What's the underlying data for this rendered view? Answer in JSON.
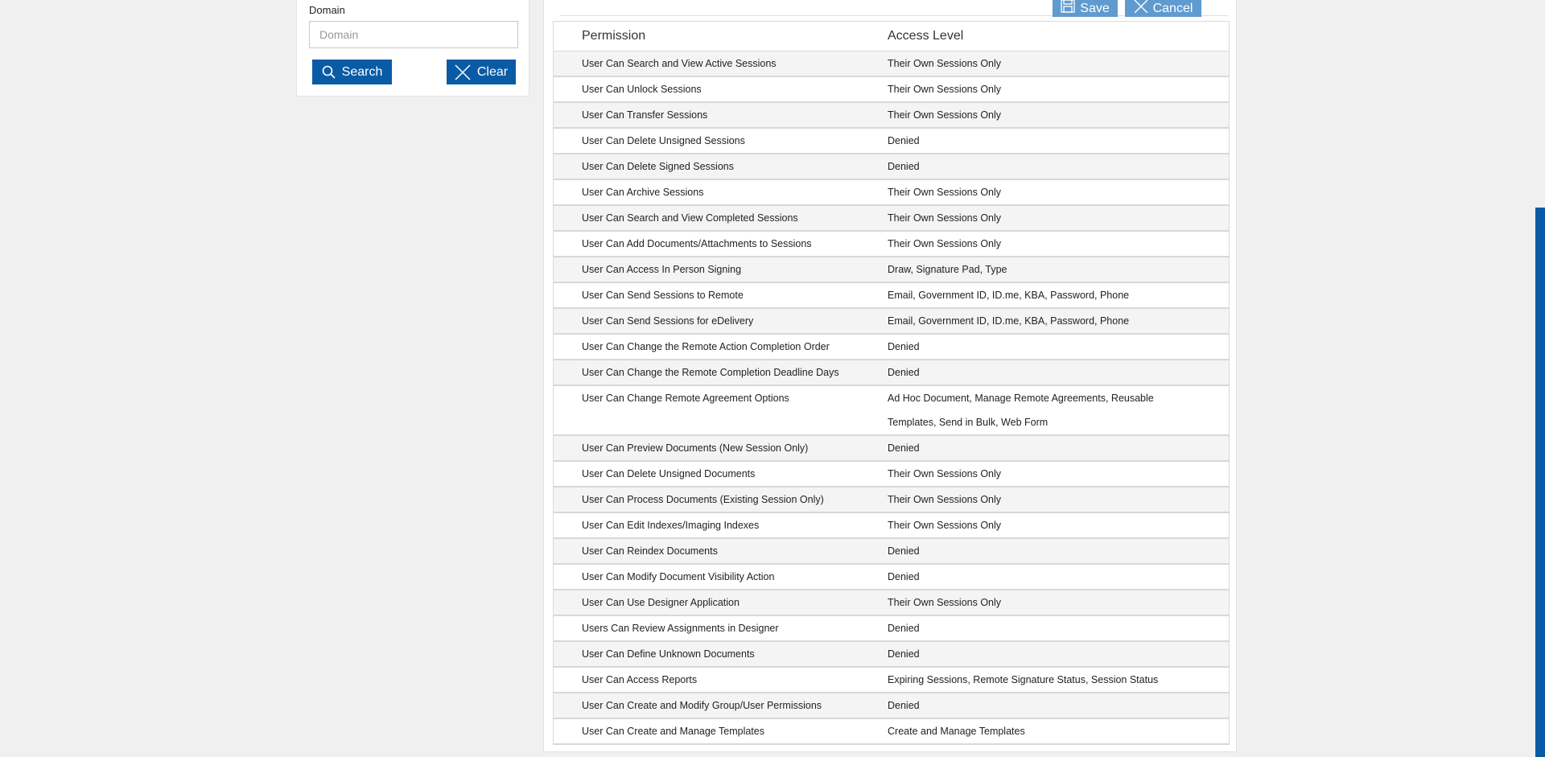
{
  "search": {
    "domain_label": "Domain",
    "domain_placeholder": "Domain",
    "domain_value": "",
    "search_label": "Search",
    "clear_label": "Clear"
  },
  "toolbar": {
    "save_label": "Save",
    "cancel_label": "Cancel"
  },
  "table": {
    "headers": [
      "Permission",
      "Access Level"
    ],
    "rows": [
      {
        "permission": "User Can Search and View Active Sessions",
        "access": "Their Own Sessions Only"
      },
      {
        "permission": "User Can Unlock Sessions",
        "access": "Their Own Sessions Only"
      },
      {
        "permission": "User Can Transfer Sessions",
        "access": "Their Own Sessions Only"
      },
      {
        "permission": "User Can Delete Unsigned Sessions",
        "access": "Denied"
      },
      {
        "permission": "User Can Delete Signed Sessions",
        "access": "Denied"
      },
      {
        "permission": "User Can Archive Sessions",
        "access": "Their Own Sessions Only"
      },
      {
        "permission": "User Can Search and View Completed Sessions",
        "access": "Their Own Sessions Only"
      },
      {
        "permission": "User Can Add Documents/Attachments to Sessions",
        "access": "Their Own Sessions Only"
      },
      {
        "permission": "User Can Access In Person Signing",
        "access": "Draw, Signature Pad, Type"
      },
      {
        "permission": "User Can Send Sessions to Remote",
        "access": "Email, Government ID, ID.me, KBA, Password, Phone"
      },
      {
        "permission": "User Can Send Sessions for eDelivery",
        "access": "Email, Government ID, ID.me, KBA, Password, Phone"
      },
      {
        "permission": "User Can Change the Remote Action Completion Order",
        "access": "Denied"
      },
      {
        "permission": "User Can Change the Remote Completion Deadline Days",
        "access": "Denied"
      },
      {
        "permission": "User Can Change Remote Agreement Options",
        "access": "Ad Hoc Document, Manage Remote Agreements, Reusable Templates, Send in Bulk, Web Form"
      },
      {
        "permission": "User Can Preview Documents (New Session Only)",
        "access": "Denied"
      },
      {
        "permission": "User Can Delete Unsigned Documents",
        "access": "Their Own Sessions Only"
      },
      {
        "permission": "User Can Process Documents (Existing Session Only)",
        "access": "Their Own Sessions Only"
      },
      {
        "permission": "User Can Edit Indexes/Imaging Indexes",
        "access": "Their Own Sessions Only"
      },
      {
        "permission": "User Can Reindex Documents",
        "access": "Denied"
      },
      {
        "permission": "User Can Modify Document Visibility Action",
        "access": "Denied"
      },
      {
        "permission": "User Can Use Designer Application",
        "access": "Their Own Sessions Only"
      },
      {
        "permission": "Users Can Review Assignments in Designer",
        "access": "Denied"
      },
      {
        "permission": "User Can Define Unknown Documents",
        "access": "Denied"
      },
      {
        "permission": "User Can Access Reports",
        "access": "Expiring Sessions, Remote Signature Status, Session Status"
      },
      {
        "permission": "User Can Create and Modify Group/User Permissions",
        "access": "Denied"
      },
      {
        "permission": "User Can Create and Manage Templates",
        "access": "Create and Manage Templates"
      }
    ]
  },
  "colors": {
    "primary": "#0a5ba5",
    "action": "#5e9bd0",
    "background": "#f0f0f0"
  }
}
